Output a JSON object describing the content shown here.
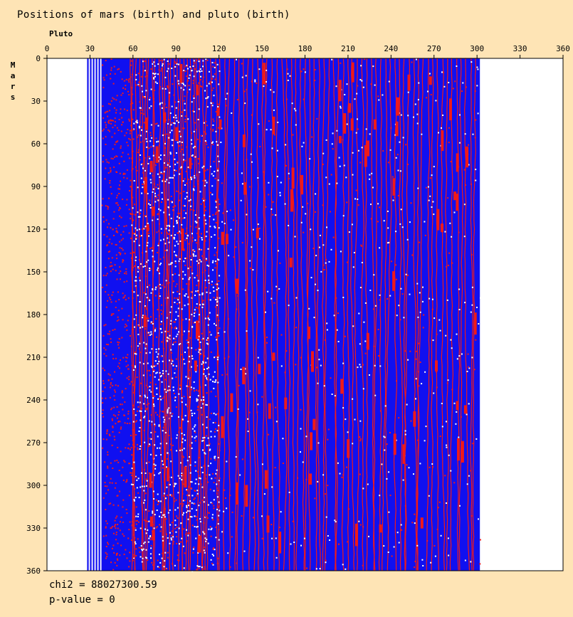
{
  "title": "Positions of mars (birth) and pluto (birth)",
  "x_axis_label": "Pluto",
  "y_axis_label": "Mars",
  "chi2_text": "chi2 = 88027300.59",
  "pvalue_text": "p-value = 0",
  "colors": {
    "background": "#fee4b5",
    "plot_empty": "#ffffff",
    "low": "#1010f0",
    "high": "#ef1a1a",
    "equal": "#ffffff"
  },
  "chart_data": {
    "type": "heatmap",
    "title": "Positions of mars (birth) and pluto (birth)",
    "xlabel": "Pluto",
    "ylabel": "Mars",
    "xlim": [
      0,
      360
    ],
    "ylim": [
      0,
      360
    ],
    "x_ticks": [
      0,
      30,
      60,
      90,
      120,
      150,
      180,
      210,
      240,
      270,
      300,
      330,
      360
    ],
    "y_ticks": [
      0,
      30,
      60,
      90,
      120,
      150,
      180,
      210,
      240,
      270,
      300,
      330,
      360
    ],
    "occupied_x_range": [
      28,
      302
    ],
    "sparse_x_band": [
      28,
      38
    ],
    "dense_x_band": [
      38,
      302
    ],
    "legend": "none",
    "grid": false,
    "statistics": {
      "chi2": 88027300.59,
      "p_value": 0
    }
  }
}
